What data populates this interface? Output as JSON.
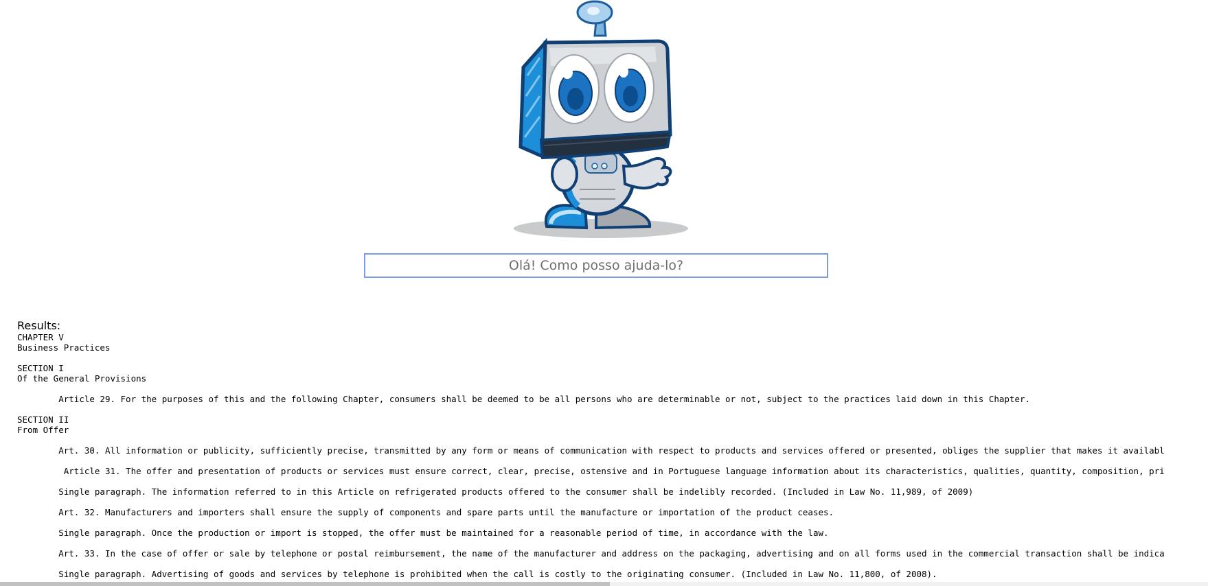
{
  "search": {
    "placeholder": "Olá! Como posso ajuda-lo?"
  },
  "mascot": {
    "icon": "robot-mascot",
    "accent": "#1b73c4"
  },
  "results": {
    "label": "Results:",
    "text": "CHAPTER V\nBusiness Practices\n\nSECTION I\nOf the General Provisions\n\n\tArticle 29. For the purposes of this and the following Chapter, consumers shall be deemed to be all persons who are determinable or not, subject to the practices laid down in this Chapter.\n\nSECTION II\nFrom Offer\n\n\tArt. 30. All information or publicity, sufficiently precise, transmitted by any form or means of communication with respect to products and services offered or presented, obliges the supplier that makes it availabl\n\n\t Article 31. The offer and presentation of products or services must ensure correct, clear, precise, ostensive and in Portuguese language information about its characteristics, qualities, quantity, composition, pri\n\n\tSingle paragraph. The information referred to in this Article on refrigerated products offered to the consumer shall be indelibly recorded. (Included in Law No. 11,989, of 2009)\n\n\tArt. 32. Manufacturers and importers shall ensure the supply of components and spare parts until the manufacture or importation of the product ceases.\n\n\tSingle paragraph. Once the production or import is stopped, the offer must be maintained for a reasonable period of time, in accordance with the law.\n\n\tArt. 33. In the case of offer or sale by telephone or postal reimbursement, the name of the manufacturer and address on the packaging, advertising and on all forms used in the commercial transaction shall be indica\n\n\tSingle paragraph. Advertising of goods and services by telephone is prohibited when the call is costly to the originating consumer. (Included in Law No. 11,800, of 2008)."
  },
  "colors": {
    "input_border": "#7b9be6",
    "scrollbar_thumb": "#c1c1c1"
  }
}
